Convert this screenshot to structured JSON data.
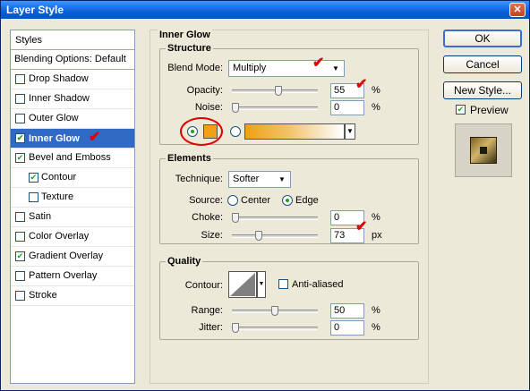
{
  "window": {
    "title": "Layer Style",
    "close_glyph": "✕"
  },
  "styles_panel": {
    "header": "Styles",
    "blending": "Blending Options: Default",
    "items": [
      {
        "label": "Drop Shadow",
        "checked": false
      },
      {
        "label": "Inner Shadow",
        "checked": false
      },
      {
        "label": "Outer Glow",
        "checked": false
      },
      {
        "label": "Inner Glow",
        "checked": true,
        "selected": true
      },
      {
        "label": "Bevel and Emboss",
        "checked": true
      },
      {
        "label": "Contour",
        "checked": true,
        "indent": true
      },
      {
        "label": "Texture",
        "checked": false,
        "indent": true
      },
      {
        "label": "Satin",
        "checked": false
      },
      {
        "label": "Color Overlay",
        "checked": false
      },
      {
        "label": "Gradient Overlay",
        "checked": true
      },
      {
        "label": "Pattern Overlay",
        "checked": false
      },
      {
        "label": "Stroke",
        "checked": false
      }
    ]
  },
  "inner_glow": {
    "title": "Inner Glow",
    "structure": {
      "legend": "Structure",
      "blend_mode_label": "Blend Mode:",
      "blend_mode": "Multiply",
      "opacity_label": "Opacity:",
      "opacity": "55",
      "opacity_unit": "%",
      "opacity_level": 0.55,
      "noise_label": "Noise:",
      "noise": "0",
      "noise_unit": "%",
      "noise_level": 0,
      "glow_color": "#f0a015"
    },
    "elements": {
      "legend": "Elements",
      "technique_label": "Technique:",
      "technique": "Softer",
      "source_label": "Source:",
      "source_center": "Center",
      "source_edge": "Edge",
      "choke_label": "Choke:",
      "choke": "0",
      "choke_unit": "%",
      "choke_level": 0,
      "size_label": "Size:",
      "size": "73",
      "size_unit": "px",
      "size_level": 0.29
    },
    "quality": {
      "legend": "Quality",
      "contour_label": "Contour:",
      "anti_aliased": "Anti-aliased",
      "range_label": "Range:",
      "range": "50",
      "range_unit": "%",
      "range_level": 0.5,
      "jitter_label": "Jitter:",
      "jitter": "0",
      "jitter_unit": "%",
      "jitter_level": 0
    }
  },
  "buttons": {
    "ok": "OK",
    "cancel": "Cancel",
    "new_style": "New Style...",
    "preview": "Preview"
  },
  "colors": {
    "selection": "#316ac5",
    "titlebar": "#0a5fd8",
    "check": "#21a121",
    "annotation": "#e00000"
  }
}
